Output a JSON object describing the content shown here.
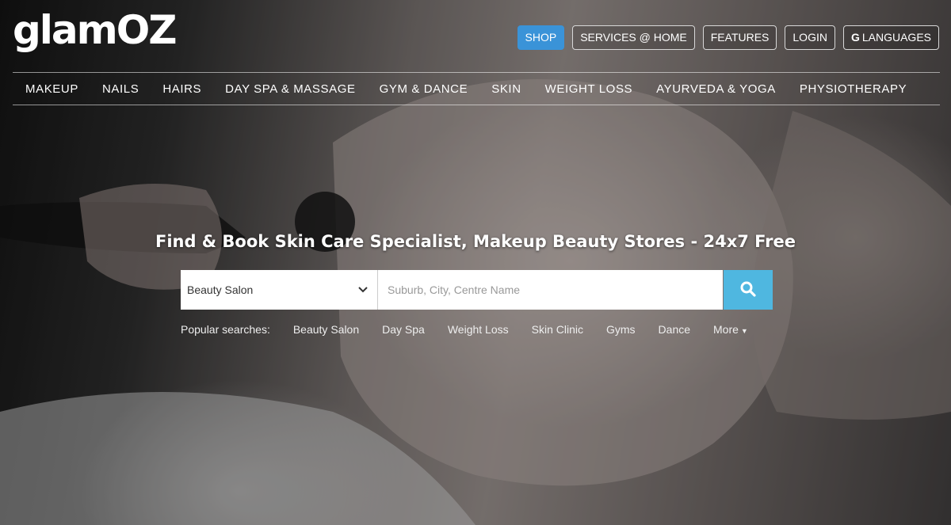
{
  "brand": {
    "logo": "glamOZ"
  },
  "top_nav": {
    "shop": "SHOP",
    "services_home": "SERVICES @ HOME",
    "features": "FEATURES",
    "login": "LOGIN",
    "languages": "LANGUAGES",
    "languages_icon": "google-g-icon"
  },
  "categories": [
    "MAKEUP",
    "NAILS",
    "HAIRS",
    "DAY SPA & MASSAGE",
    "GYM & DANCE",
    "SKIN",
    "WEIGHT LOSS",
    "AYURVEDA & YOGA",
    "PHYSIOTHERAPY"
  ],
  "hero": {
    "title": "Find & Book Skin Care Specialist, Makeup Beauty Stores - 24x7 Free"
  },
  "search": {
    "category_value": "Beauty Salon",
    "location_placeholder": "Suburb, City, Centre Name",
    "button_icon": "search-icon"
  },
  "popular": {
    "label": "Popular searches:",
    "links": [
      "Beauty Salon",
      "Day Spa",
      "Weight Loss",
      "Skin Clinic",
      "Gyms",
      "Dance"
    ],
    "more": "More"
  },
  "colors": {
    "primary": "#3a93d8",
    "search_button": "#4fb7e0"
  }
}
